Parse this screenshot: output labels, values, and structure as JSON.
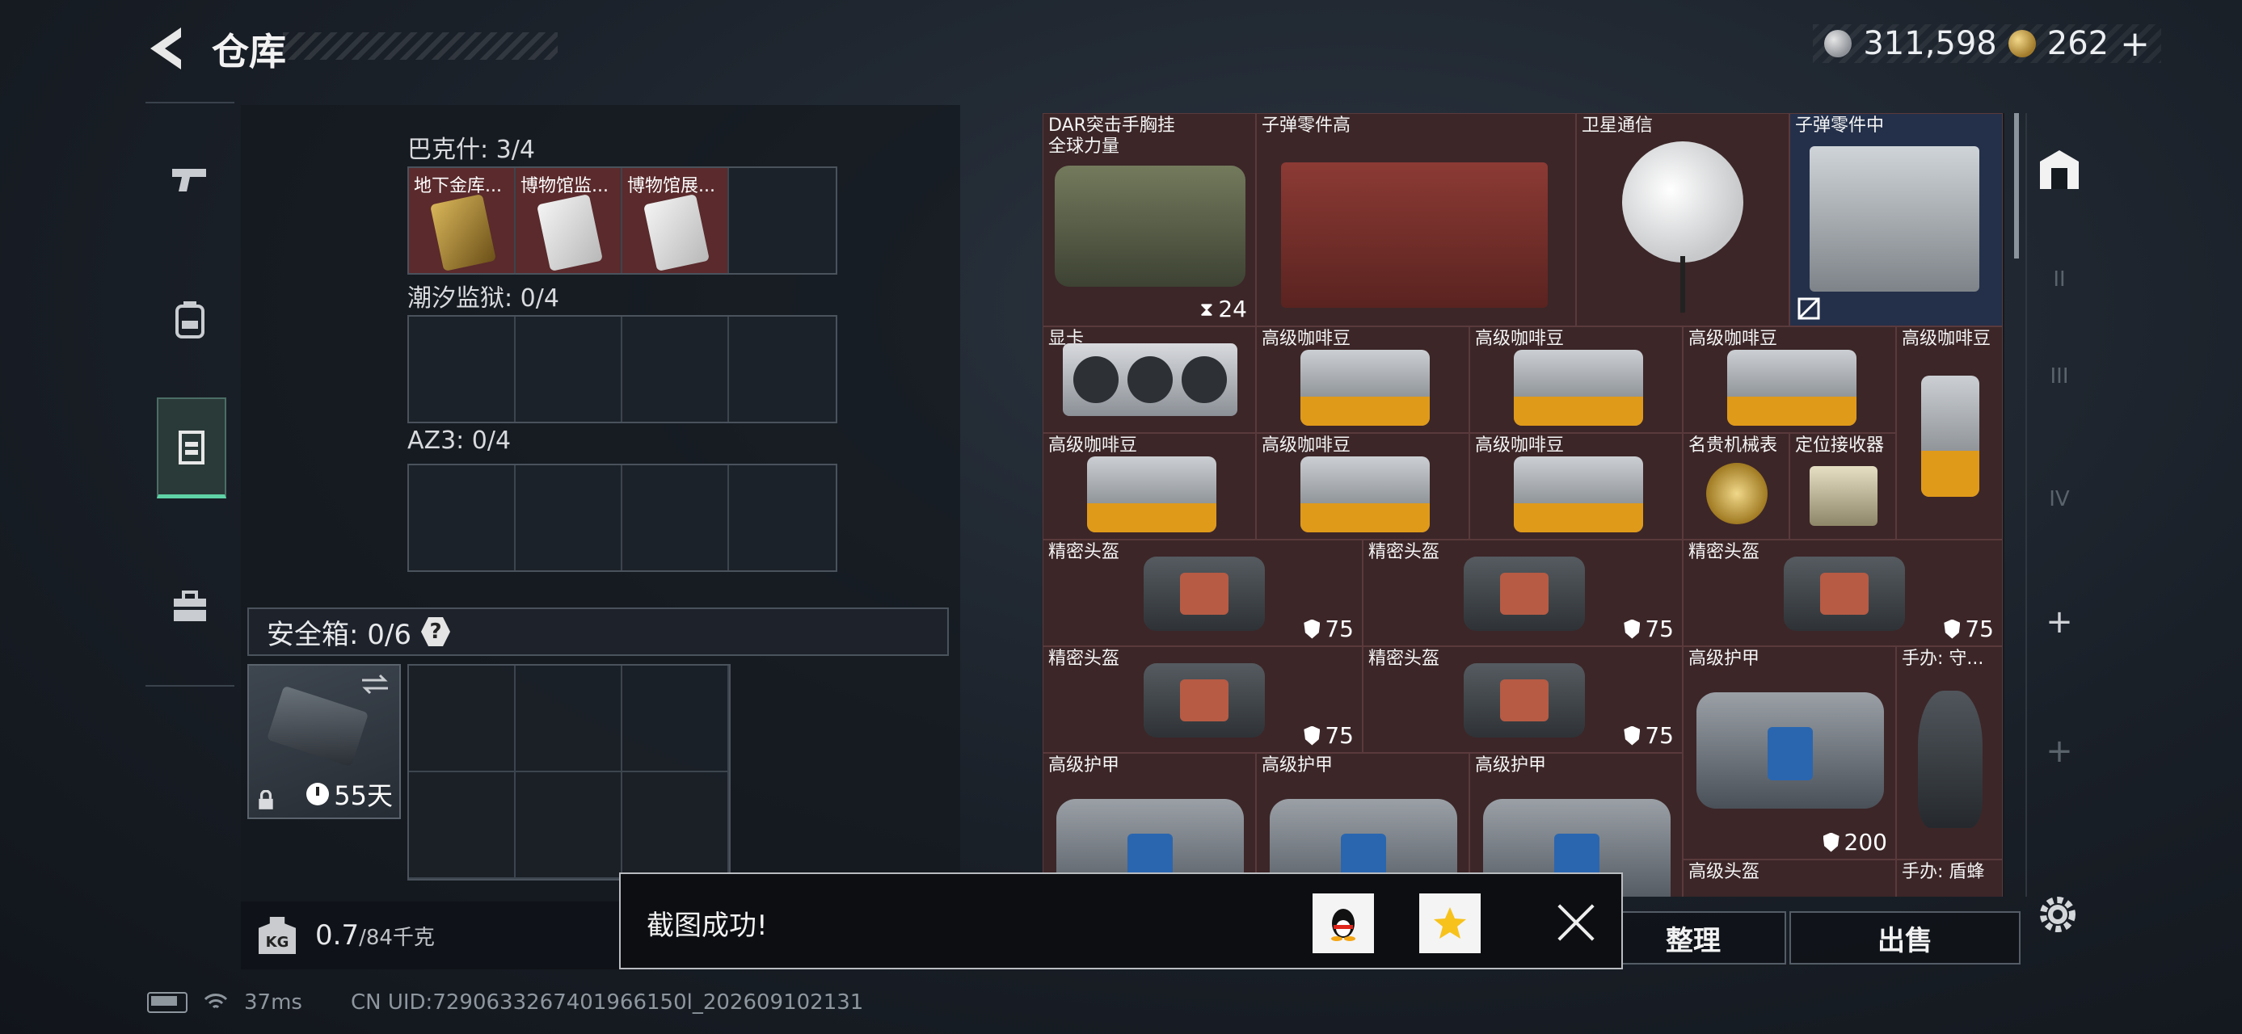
{
  "header": {
    "title": "仓库"
  },
  "currency": {
    "silver": "311,598",
    "gold": "262",
    "plus": "+"
  },
  "left_panel": {
    "sections": [
      {
        "title": "巴克什: 3/4",
        "items": [
          "地下金库...",
          "博物馆监...",
          "博物馆展..."
        ]
      },
      {
        "title": "潮汐监狱: 0/4",
        "items": []
      },
      {
        "title": "AZ3: 0/4",
        "items": []
      }
    ],
    "safe_box": {
      "title": "安全箱: 0/6",
      "help": "?",
      "days": "55天"
    },
    "weight": {
      "value": "0.7",
      "max": "/84千克",
      "icon": "KG"
    }
  },
  "stash": {
    "items": [
      {
        "label": "DAR突击手胸挂\n全球力量",
        "stat": "24"
      },
      {
        "label": "子弹零件高"
      },
      {
        "label": "卫星通信"
      },
      {
        "label": "子弹零件中"
      },
      {
        "label": "显卡"
      },
      {
        "label": "高级咖啡豆"
      },
      {
        "label": "高级咖啡豆"
      },
      {
        "label": "高级咖啡豆"
      },
      {
        "label": "高级咖啡豆"
      },
      {
        "label": "高级咖啡豆"
      },
      {
        "label": "高级咖啡豆"
      },
      {
        "label": "高级咖啡豆"
      },
      {
        "label": "名贵机械表"
      },
      {
        "label": "定位接收器"
      },
      {
        "label": "精密头盔",
        "stat": "75"
      },
      {
        "label": "精密头盔",
        "stat": "75"
      },
      {
        "label": "精密头盔",
        "stat": "75"
      },
      {
        "label": "精密头盔",
        "stat": "75"
      },
      {
        "label": "精密头盔",
        "stat": "75"
      },
      {
        "label": "高级护甲",
        "stat": "200"
      },
      {
        "label": "手办: 守..."
      },
      {
        "label": "高级护甲"
      },
      {
        "label": "高级护甲"
      },
      {
        "label": "高级护甲"
      },
      {
        "label": "高级头盔"
      },
      {
        "label": "手办: 盾蜂"
      }
    ]
  },
  "buttons": {
    "organize": "整理",
    "sell": "出售"
  },
  "toast": {
    "message": "截图成功!"
  },
  "right_toolbar": {
    "tabs": [
      "II",
      "III",
      "IV"
    ],
    "plus": "+"
  },
  "status": {
    "ping": "37ms",
    "uid": "CN UID:7290633267401966150l_202609102131"
  },
  "colors": {
    "accent": "#5fd3a6",
    "item_bg": "#3c2628"
  }
}
